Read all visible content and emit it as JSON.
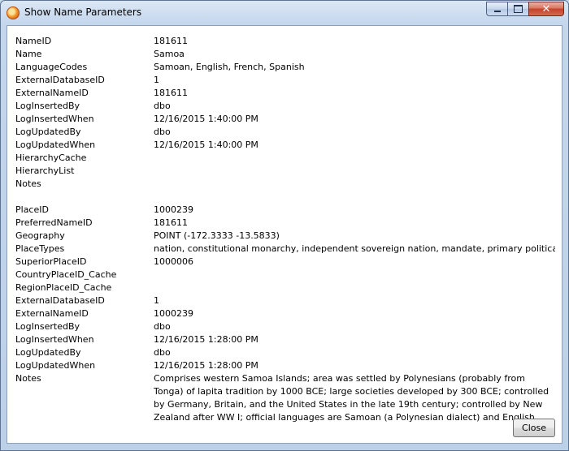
{
  "window": {
    "title": "Show Name Parameters"
  },
  "name_params": [
    {
      "key": "NameID",
      "value": "181611"
    },
    {
      "key": "Name",
      "value": "Samoa"
    },
    {
      "key": "LanguageCodes",
      "value": "Samoan, English, French, Spanish"
    },
    {
      "key": "ExternalDatabaseID",
      "value": "1"
    },
    {
      "key": "ExternalNameID",
      "value": "181611"
    },
    {
      "key": "LogInsertedBy",
      "value": "dbo"
    },
    {
      "key": "LogInsertedWhen",
      "value": "12/16/2015 1:40:00 PM"
    },
    {
      "key": "LogUpdatedBy",
      "value": "dbo"
    },
    {
      "key": "LogUpdatedWhen",
      "value": "12/16/2015 1:40:00 PM"
    },
    {
      "key": "HierarchyCache",
      "value": ""
    },
    {
      "key": "HierarchyList",
      "value": ""
    },
    {
      "key": "Notes",
      "value": ""
    }
  ],
  "place_params": [
    {
      "key": "PlaceID",
      "value": "1000239"
    },
    {
      "key": "PreferredNameID",
      "value": "181611"
    },
    {
      "key": "Geography",
      "value": "POINT (-172.3333 -13.5833)"
    },
    {
      "key": "PlaceTypes",
      "value": "nation, constitutional monarchy, independent sovereign nation, mandate, primary political un"
    },
    {
      "key": "SuperiorPlaceID",
      "value": "1000006"
    },
    {
      "key": "CountryPlaceID_Cache",
      "value": ""
    },
    {
      "key": "RegionPlaceID_Cache",
      "value": ""
    },
    {
      "key": "ExternalDatabaseID",
      "value": "1"
    },
    {
      "key": "ExternalNameID",
      "value": "1000239"
    },
    {
      "key": "LogInsertedBy",
      "value": "dbo"
    },
    {
      "key": "LogInsertedWhen",
      "value": "12/16/2015 1:28:00 PM"
    },
    {
      "key": "LogUpdatedBy",
      "value": "dbo"
    },
    {
      "key": "LogUpdatedWhen",
      "value": "12/16/2015 1:28:00 PM"
    },
    {
      "key": "Notes",
      "value": "Comprises western Samoa Islands; area was settled by Polynesians (probably from Tonga) of lapita tradition by 1000 BCE; large societies developed by 300 BCE; controlled by Germany, Britain, and the United States in the late 19th century; controlled by New Zealand after WW I; official languages are Samoan (a Polynesian dialect) and English."
    }
  ],
  "buttons": {
    "close_label": "Close"
  },
  "icons": {
    "app": "app-icon",
    "minimize": "minimize-icon",
    "maximize": "maximize-icon",
    "close": "close-icon"
  }
}
